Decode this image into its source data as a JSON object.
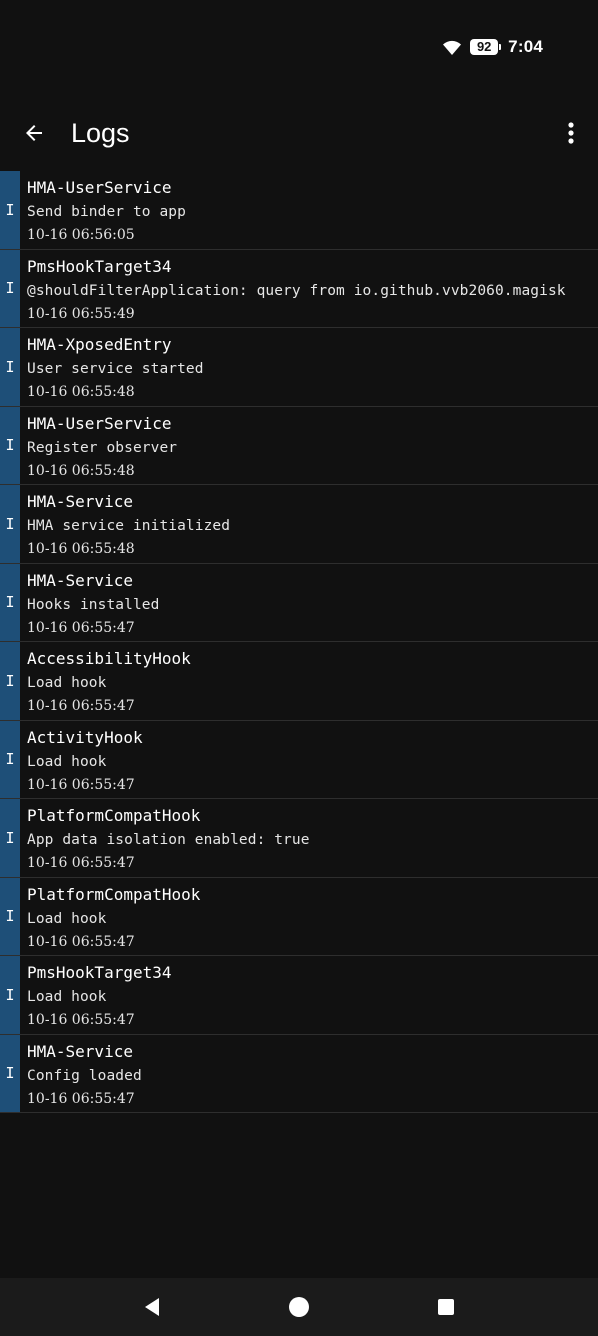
{
  "status_bar": {
    "time": "7:04",
    "battery": "92",
    "icons": [
      "wifi-icon",
      "battery-icon"
    ]
  },
  "app_bar": {
    "title": "Logs",
    "back_icon": "arrow-left-icon",
    "menu_icon": "more-vertical-icon"
  },
  "colors": {
    "background": "#111111",
    "level_info": "#1e4f78",
    "divider": "#2e2e2e"
  },
  "logs": [
    {
      "level": "I",
      "tag": "HMA-UserService",
      "message": "Send binder to app",
      "time": "10-16 06:56:05"
    },
    {
      "level": "I",
      "tag": "PmsHookTarget34",
      "message": "@shouldFilterApplication: query from io.github.vvb2060.magisk",
      "time": "10-16 06:55:49"
    },
    {
      "level": "I",
      "tag": "HMA-XposedEntry",
      "message": "User service started",
      "time": "10-16 06:55:48"
    },
    {
      "level": "I",
      "tag": "HMA-UserService",
      "message": "Register observer",
      "time": "10-16 06:55:48"
    },
    {
      "level": "I",
      "tag": "HMA-Service",
      "message": "HMA service initialized",
      "time": "10-16 06:55:48"
    },
    {
      "level": "I",
      "tag": "HMA-Service",
      "message": "Hooks installed",
      "time": "10-16 06:55:47"
    },
    {
      "level": "I",
      "tag": "AccessibilityHook",
      "message": "Load hook",
      "time": "10-16 06:55:47"
    },
    {
      "level": "I",
      "tag": "ActivityHook",
      "message": "Load hook",
      "time": "10-16 06:55:47"
    },
    {
      "level": "I",
      "tag": "PlatformCompatHook",
      "message": "App data isolation enabled: true",
      "time": "10-16 06:55:47"
    },
    {
      "level": "I",
      "tag": "PlatformCompatHook",
      "message": "Load hook",
      "time": "10-16 06:55:47"
    },
    {
      "level": "I",
      "tag": "PmsHookTarget34",
      "message": "Load hook",
      "time": "10-16 06:55:47"
    },
    {
      "level": "I",
      "tag": "HMA-Service",
      "message": "Config loaded",
      "time": "10-16 06:55:47"
    }
  ],
  "nav_bar": {
    "icons": [
      "nav-back-icon",
      "nav-home-icon",
      "nav-recents-icon"
    ]
  }
}
